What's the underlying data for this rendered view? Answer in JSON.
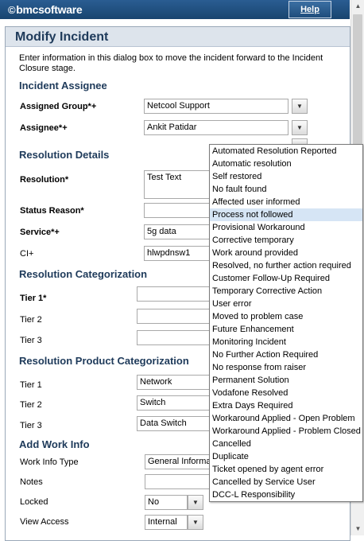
{
  "header": {
    "logo_text": "bmcsoftware",
    "help_label": "Help"
  },
  "dialog": {
    "title": "Modify Incident",
    "intro": "Enter information in this dialog box to move the incident forward to the Incident Closure stage."
  },
  "incident_assignee": {
    "heading": "Incident Assignee",
    "assigned_group_label": "Assigned Group*+",
    "assigned_group_value": "Netcool Support",
    "assignee_label": "Assignee*+",
    "assignee_value": "Ankit Patidar"
  },
  "resolution_details": {
    "heading": "Resolution Details",
    "resolution_label": "Resolution*",
    "resolution_value": "Test Text",
    "status_reason_label": "Status Reason*",
    "service_label": "Service*+",
    "service_value": "5g data",
    "ci_label": "CI+",
    "ci_value": "hlwpdnsw1"
  },
  "resolution_categorization": {
    "heading": "Resolution Categorization",
    "tier1_label": "Tier 1*",
    "tier2_label": "Tier 2",
    "tier3_label": "Tier 3"
  },
  "resolution_product_categorization": {
    "heading": "Resolution Product Categorization",
    "tier1_label": "Tier 1",
    "tier1_value": "Network",
    "tier2_label": "Tier 2",
    "tier2_value": "Switch",
    "tier3_label": "Tier 3",
    "tier3_value": "Data Switch"
  },
  "work_info": {
    "heading": "Add Work Info",
    "type_label": "Work Info Type",
    "type_value": "General Informa",
    "notes_label": "Notes",
    "locked_label": "Locked",
    "locked_value": "No",
    "view_access_label": "View Access",
    "view_access_value": "Internal"
  },
  "status_reason_menu": {
    "selected": "Process not followed",
    "items": [
      "Automated Resolution Reported",
      "Automatic resolution",
      "Self restored",
      "No fault found",
      "Affected user informed",
      "Process not followed",
      "Provisional Workaround",
      "Corrective temporary",
      "Work around provided",
      "Resolved, no further action required",
      "Customer Follow-Up Required",
      "Temporary Corrective Action",
      "User error",
      "Moved to problem case",
      "Future Enhancement",
      "Monitoring Incident",
      "No Further Action Required",
      "No response from raiser",
      "Permanent Solution",
      "Vodafone Resolved",
      "Extra Days Required",
      "Workaround Applied - Open Problem",
      "Workaround Applied - Problem Closed",
      "Cancelled",
      "Duplicate",
      "Ticket opened by agent error",
      "Cancelled by Service User",
      "DCC-L Responsibility"
    ]
  },
  "icons": {
    "dropdown": "chevron-down-icon",
    "scroll_up": "scroll-up-arrow-icon",
    "scroll_down": "scroll-down-arrow-icon"
  }
}
